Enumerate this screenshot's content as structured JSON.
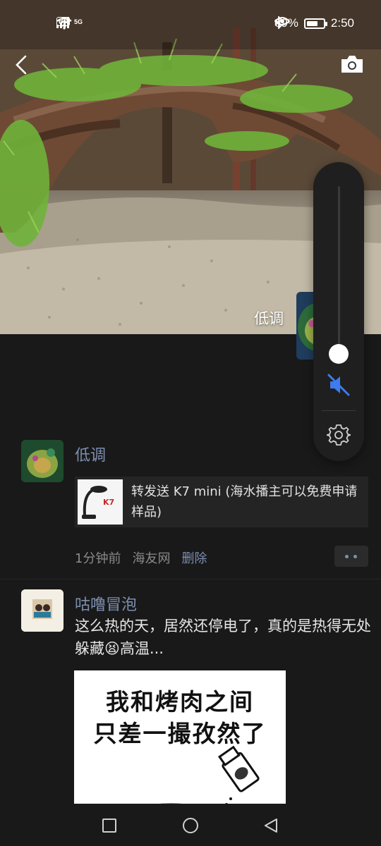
{
  "status_bar": {
    "hd": "HD",
    "network": "5G",
    "battery_percent": "69%",
    "battery_level": 0.69,
    "time": "2:50"
  },
  "cover": {
    "user_name": "低调"
  },
  "volume": {
    "level": 0.0,
    "muted": true
  },
  "posts": [
    {
      "author": "低调",
      "shared_title": "转发送 K7 mini (海水播主可以免费申请样品)",
      "shared_thumb_brand": "K7",
      "time": "1分钟前",
      "source": "海友网",
      "delete_label": "删除"
    },
    {
      "author": "咕噜冒泡",
      "text": "这么热的天，居然还停电了，真的是热得无处躲藏😫高温...",
      "image_text_line1": "我和烤肉之间",
      "image_text_line2": "只差一撮孜然了"
    }
  ],
  "colors": {
    "background": "#191919",
    "author_link": "#7d8fb0",
    "meta": "#8a8a8a"
  },
  "icons": [
    "back-icon",
    "camera-icon",
    "mute-icon",
    "settings-icon",
    "square-icon",
    "circle-icon",
    "triangle-back-icon"
  ]
}
